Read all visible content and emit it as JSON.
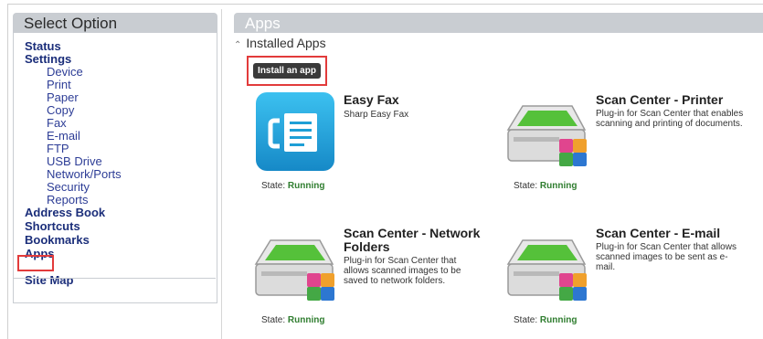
{
  "left_panel": {
    "title": "Select Option",
    "nav": {
      "status": "Status",
      "settings": "Settings",
      "settings_children": [
        "Device",
        "Print",
        "Paper",
        "Copy",
        "Fax",
        "E-mail",
        "FTP",
        "USB Drive",
        "Network/Ports",
        "Security",
        "Reports"
      ],
      "address_book": "Address Book",
      "shortcuts": "Shortcuts",
      "bookmarks": "Bookmarks",
      "apps": "Apps",
      "site_map": "Site Map"
    }
  },
  "main": {
    "title": "Apps",
    "section_label": "Installed Apps",
    "install_button": "Install an app",
    "state_label": "State:",
    "apps": [
      {
        "name": "Easy Fax",
        "description": "Sharp Easy Fax",
        "state": "Running",
        "icon": "fax-app-icon"
      },
      {
        "name": "Scan Center - Printer",
        "description": "Plug-in for Scan Center that enables scanning and printing of documents.",
        "state": "Running",
        "icon": "scanner-icon"
      },
      {
        "name": "Scan Center - Network Folders",
        "description": "Plug-in for Scan Center that allows scanned images to be saved to network folders.",
        "state": "Running",
        "icon": "scanner-icon"
      },
      {
        "name": "Scan Center - E-mail",
        "description": "Plug-in for Scan Center that allows scanned images to be sent as e-mail.",
        "state": "Running",
        "icon": "scanner-icon"
      }
    ]
  },
  "colors": {
    "header_bg": "#c9cdd2",
    "nav_text": "#1b2e7a",
    "highlight": "#e23b3b",
    "running": "#2f7d2f",
    "fax_blue": "#1e9fd6"
  }
}
